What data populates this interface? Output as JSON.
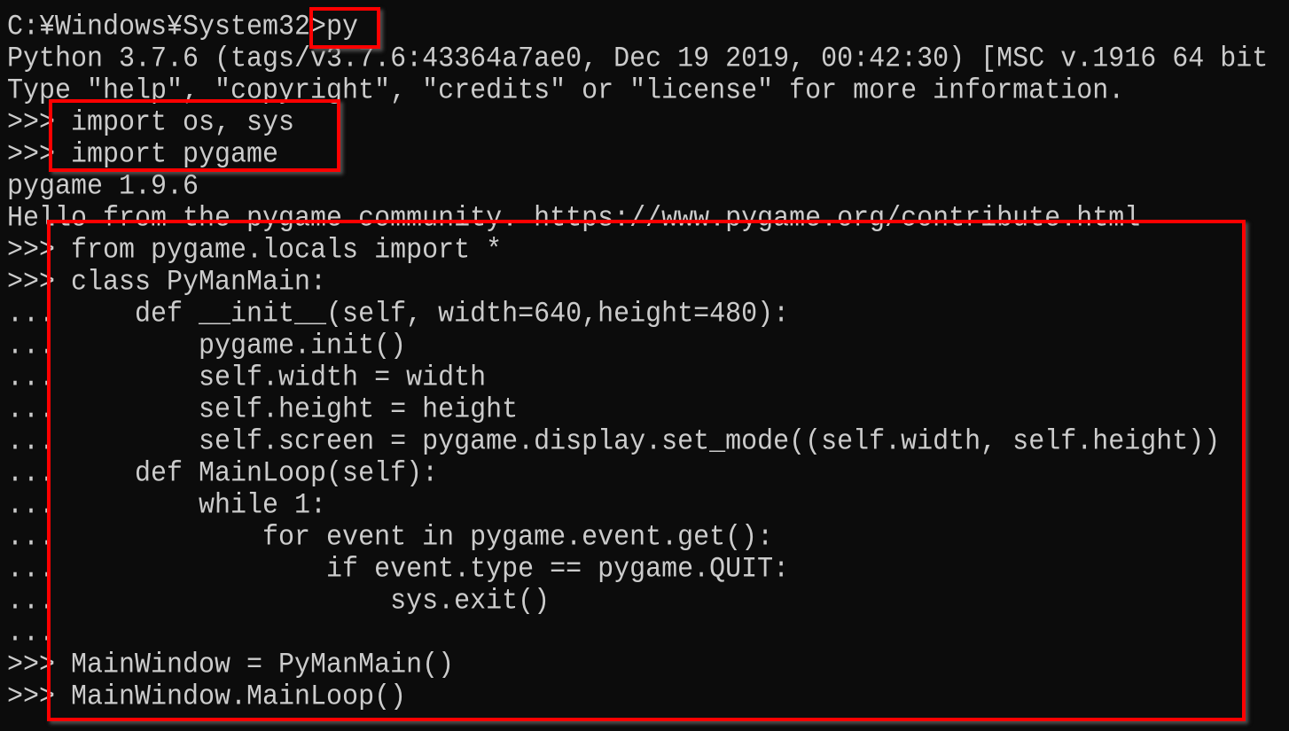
{
  "terminal": {
    "lines": [
      "C:¥Windows¥System32>py",
      "Python 3.7.6 (tags/v3.7.6:43364a7ae0, Dec 19 2019, 00:42:30) [MSC v.1916 64 bit",
      "Type \"help\", \"copyright\", \"credits\" or \"license\" for more information.",
      ">>> import os, sys",
      ">>> import pygame",
      "pygame 1.9.6",
      "Hello from the pygame community. https://www.pygame.org/contribute.html",
      ">>> from pygame.locals import *",
      ">>> class PyManMain:",
      "...     def __init__(self, width=640,height=480):",
      "...         pygame.init()",
      "...         self.width = width",
      "...         self.height = height",
      "...         self.screen = pygame.display.set_mode((self.width, self.height))",
      "...     def MainLoop(self):",
      "...         while 1:",
      "...             for event in pygame.event.get():",
      "...                 if event.type == pygame.QUIT:",
      "...                     sys.exit()",
      "...",
      ">>> MainWindow = PyManMain()",
      ">>> MainWindow.MainLoop()"
    ]
  },
  "highlight_color": "#ff0000",
  "text_color": "#cccccc",
  "background_color": "#0c0c0c"
}
